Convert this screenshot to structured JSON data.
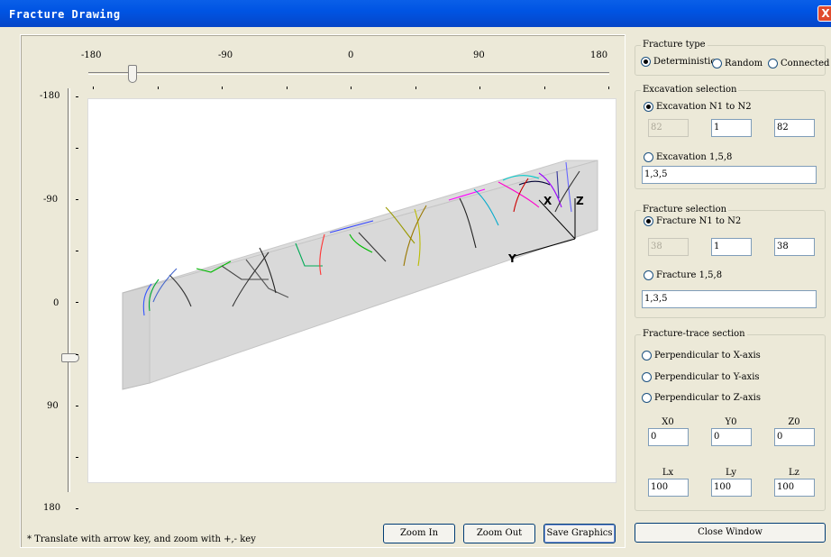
{
  "window": {
    "title": "Fracture Drawing",
    "close_glyph": "X"
  },
  "horizontal_scale": {
    "labels": [
      "-180",
      "-90",
      "0",
      "90",
      "180"
    ],
    "slider_value": -150
  },
  "vertical_scale": {
    "labels": [
      "-180",
      "-90",
      "0",
      "90",
      "180"
    ],
    "slider_value": 45
  },
  "hint": "* Translate with arrow key, and zoom with +,- key",
  "buttons": {
    "zoom_in": "Zoom In",
    "zoom_out": "Zoom Out",
    "save_graphics": "Save Graphics",
    "close_window": "Close Window"
  },
  "axes": {
    "x": "X",
    "y": "Y",
    "z": "Z"
  },
  "fracture_type": {
    "legend": "Fracture type",
    "options": [
      "Deterministic",
      "Random",
      "Connected"
    ],
    "selected": "Deterministic"
  },
  "excavation_selection": {
    "legend": "Excavation selection",
    "range_label": "Excavation N1 to N2",
    "range_values": [
      "82",
      "1",
      "82"
    ],
    "list_label": "Excavation 1,5,8",
    "list_value": "1,3,5",
    "selected": "range"
  },
  "fracture_selection": {
    "legend": "Fracture selection",
    "range_label": "Fracture N1 to N2",
    "range_values": [
      "38",
      "1",
      "38"
    ],
    "list_label": "Fracture 1,5,8",
    "list_value": "1,3,5",
    "selected": "range"
  },
  "trace_section": {
    "legend": "Fracture-trace section",
    "options": [
      "Perpendicular to X-axis",
      "Perpendicular to Y-axis",
      "Perpendicular to Z-axis"
    ],
    "origin_labels": [
      "X0",
      "Y0",
      "Z0"
    ],
    "origin_values": [
      "0",
      "0",
      "0"
    ],
    "length_labels": [
      "Lx",
      "Ly",
      "Lz"
    ],
    "length_values": [
      "100",
      "100",
      "100"
    ]
  },
  "colors": {
    "titlebar": "#0054e3",
    "surface": "#d9d9d9",
    "face": "#ece9d8"
  }
}
